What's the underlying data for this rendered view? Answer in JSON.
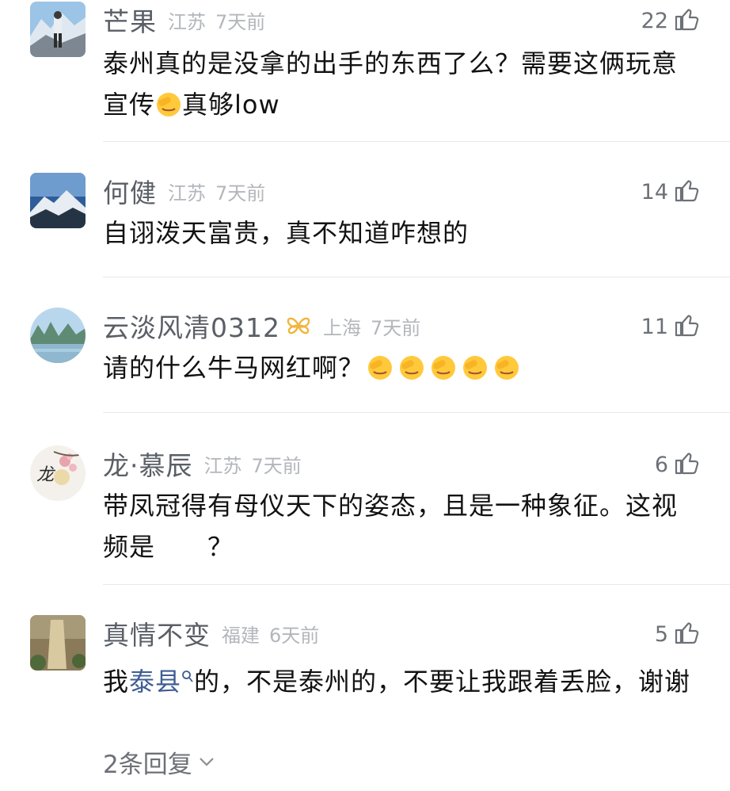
{
  "comments": [
    {
      "user": "芒果",
      "location": "江苏",
      "time": "7天前",
      "likes": "22",
      "text_a": "泰州真的是没拿的出手的东西了么？需要这俩玩意宣传",
      "text_b": "真够low"
    },
    {
      "user": "何健",
      "location": "江苏",
      "time": "7天前",
      "likes": "14",
      "text": "自诩泼天富贵，真不知道咋想的"
    },
    {
      "user": "云淡风清0312",
      "location": "上海",
      "time": "7天前",
      "likes": "11",
      "text": "请的什么牛马网红啊？"
    },
    {
      "user": "龙·慕辰",
      "location": "江苏",
      "time": "7天前",
      "likes": "6",
      "text_a": "带凤冠得有母仪天下的姿态，且是一种象征。这视频是",
      "text_b": "？"
    },
    {
      "user": "真情不变",
      "location": "福建",
      "time": "6天前",
      "likes": "5",
      "text_a": "我",
      "link": "泰县",
      "text_b": "的，不是泰州的，不要让我跟着丢脸，谢谢"
    }
  ],
  "replies_label": "2条回复",
  "colors": {
    "name": "#5a5f66",
    "meta": "#b3b6bb",
    "link": "#3f5c93",
    "badge": "#f2b43c"
  }
}
